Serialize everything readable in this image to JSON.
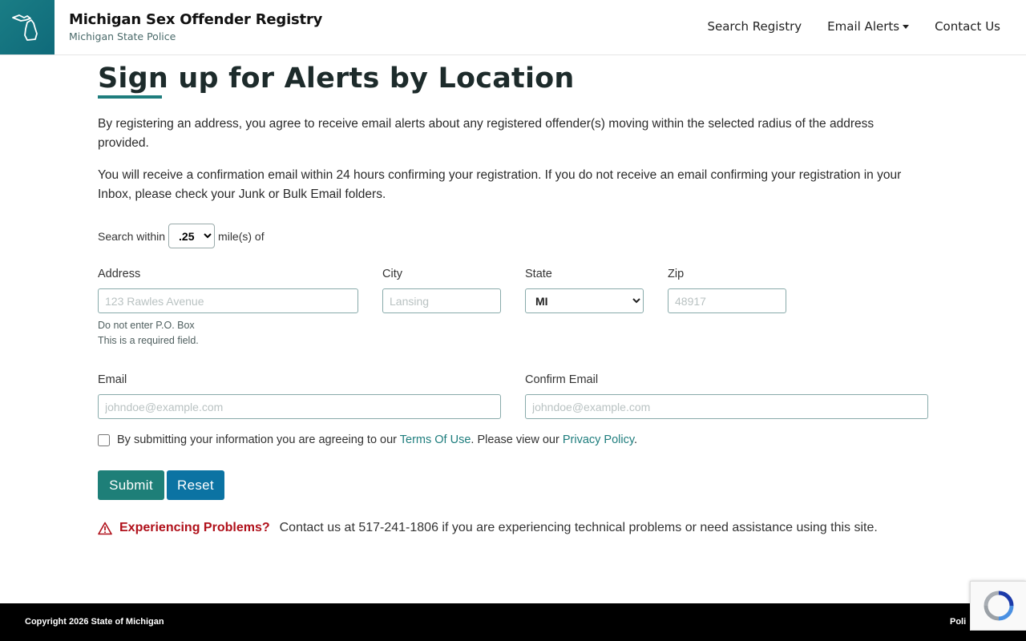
{
  "header": {
    "title": "Michigan Sex Offender Registry",
    "subtitle": "Michigan State Police",
    "logo_icon": "michigan-state-icon",
    "nav": [
      {
        "label": "Search Registry"
      },
      {
        "label": "Email Alerts"
      },
      {
        "label": "Contact Us"
      }
    ]
  },
  "main": {
    "title": "Sign up for Alerts by Location",
    "para1": "By registering an address, you agree to receive email alerts about any registered offender(s) moving within the selected radius of the address provided.",
    "para2": "You will receive a confirmation email within 24 hours confirming your registration. If you do not receive an email confirming your registration in your Inbox, please check your Junk or Bulk Email folders."
  },
  "radius": {
    "prefix": "Search within",
    "value": ".25",
    "suffix": "mile(s) of"
  },
  "address": {
    "label": "Address",
    "placeholder": "123 Rawles Avenue",
    "hint1": "Do not enter P.O. Box",
    "hint2": "This is a required field."
  },
  "city": {
    "label": "City",
    "placeholder": "Lansing"
  },
  "state": {
    "label": "State",
    "value": "MI"
  },
  "zip": {
    "label": "Zip",
    "placeholder": "48917"
  },
  "email": {
    "label": "Email",
    "placeholder": "johndoe@example.com"
  },
  "confirm_email": {
    "label": "Confirm Email",
    "placeholder": "johndoe@example.com"
  },
  "agreement": {
    "text1": "By submitting your information you are agreeing to our",
    "terms": "Terms Of Use",
    "text2": ". Please view our",
    "privacy": "Privacy Policy",
    "text3": "."
  },
  "buttons": {
    "submit": "Submit",
    "reset": "Reset"
  },
  "problems": {
    "title": "Experiencing Problems?",
    "text": "Contact us at 517-241-1806 if you are experiencing technical problems or need assistance using this site."
  },
  "footer": {
    "copyright": "Copyright 2026 State of Michigan",
    "policy_partial": "Poli"
  },
  "colors": {
    "teal": "#1e7d7d",
    "submit": "#1e7f78",
    "reset": "#0b73a3",
    "warning": "#b0101a"
  }
}
